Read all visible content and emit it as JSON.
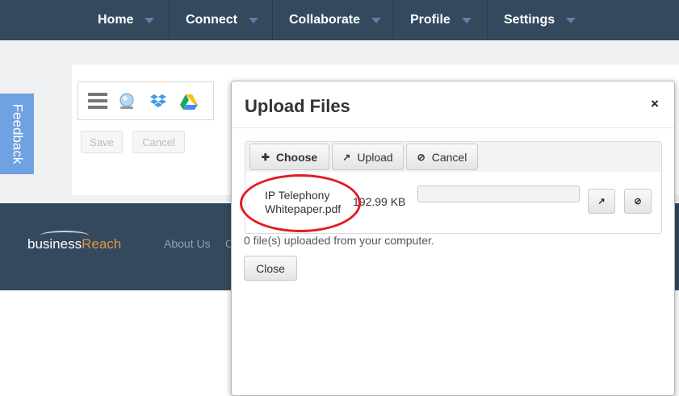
{
  "nav": {
    "items": [
      {
        "label": "Home"
      },
      {
        "label": "Connect"
      },
      {
        "label": "Collaborate"
      },
      {
        "label": "Profile"
      },
      {
        "label": "Settings"
      }
    ]
  },
  "feedback": {
    "label": "Feedback"
  },
  "sources": {
    "icons": [
      "list-icon",
      "computer-icon",
      "dropbox-icon",
      "google-drive-icon"
    ]
  },
  "form": {
    "save_label": "Save",
    "cancel_label": "Cancel"
  },
  "footer": {
    "brand_part1": "business",
    "brand_part2": "Reach",
    "link_about": "About Us",
    "link_second": "C"
  },
  "dialog": {
    "title": "Upload Files",
    "close_icon": "×",
    "toolbar": {
      "choose_label": "Choose",
      "upload_label": "Upload",
      "cancel_label": "Cancel"
    },
    "file": {
      "name": "IP Telephony Whitepaper.pdf",
      "size": "192.99 KB",
      "progress": 0
    },
    "status": "0 file(s) uploaded from your computer.",
    "close_label": "Close"
  },
  "colors": {
    "nav_bg": "#34495e",
    "caret": "#5d7fa8",
    "feedback_bg": "#6fa2e0",
    "brand_accent": "#e8963f",
    "annotation": "#e31b23"
  }
}
